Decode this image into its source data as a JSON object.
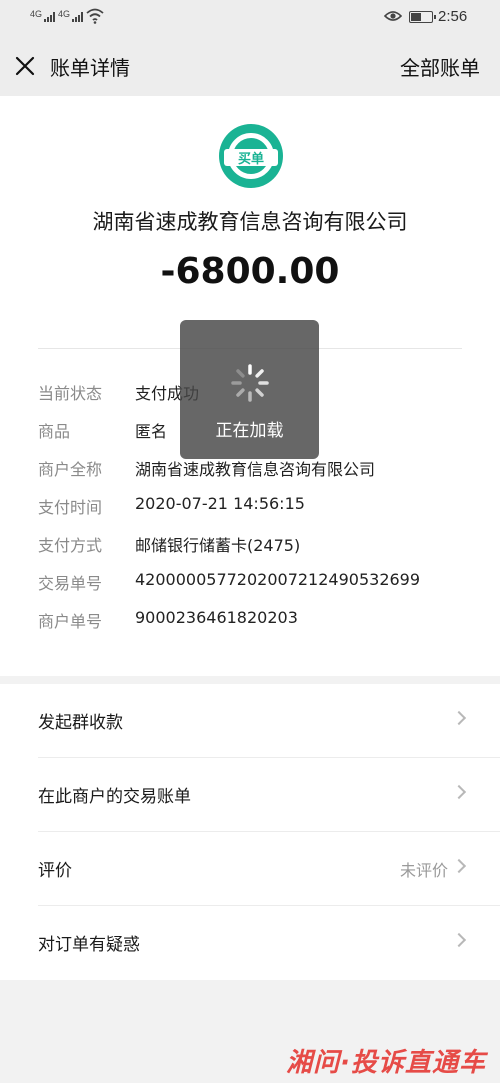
{
  "status_bar": {
    "signal_1": "4G",
    "signal_2": "4G",
    "time": "2:56",
    "battery_level": 0.55
  },
  "nav": {
    "title": "账单详情",
    "right_link": "全部账单"
  },
  "bill": {
    "logo_text": "买单",
    "merchant_title": "湖南省速成教育信息咨询有限公司",
    "amount": "-6800.00"
  },
  "details": [
    {
      "key": "当前状态",
      "value": "支付成功"
    },
    {
      "key": "商品",
      "value": "匿名"
    },
    {
      "key": "商户全称",
      "value": "湖南省速成教育信息咨询有限公司"
    },
    {
      "key": "支付时间",
      "value": "2020-07-21 14:56:15"
    },
    {
      "key": "支付方式",
      "value": "邮储银行储蓄卡(2475)"
    },
    {
      "key": "交易单号",
      "value": "4200000577202007212490532699"
    },
    {
      "key": "商户单号",
      "value": "9000236461820203"
    }
  ],
  "menu": [
    {
      "label": "发起群收款",
      "value": ""
    },
    {
      "label": "在此商户的交易账单",
      "value": ""
    },
    {
      "label": "评价",
      "value": "未评价"
    },
    {
      "label": "对订单有疑惑",
      "value": ""
    }
  ],
  "loading": {
    "text": "正在加载"
  },
  "watermark": {
    "text": "湘问·投诉直通车"
  },
  "colors": {
    "brand_green": "#1ab394",
    "watermark_red": "#e53935"
  }
}
